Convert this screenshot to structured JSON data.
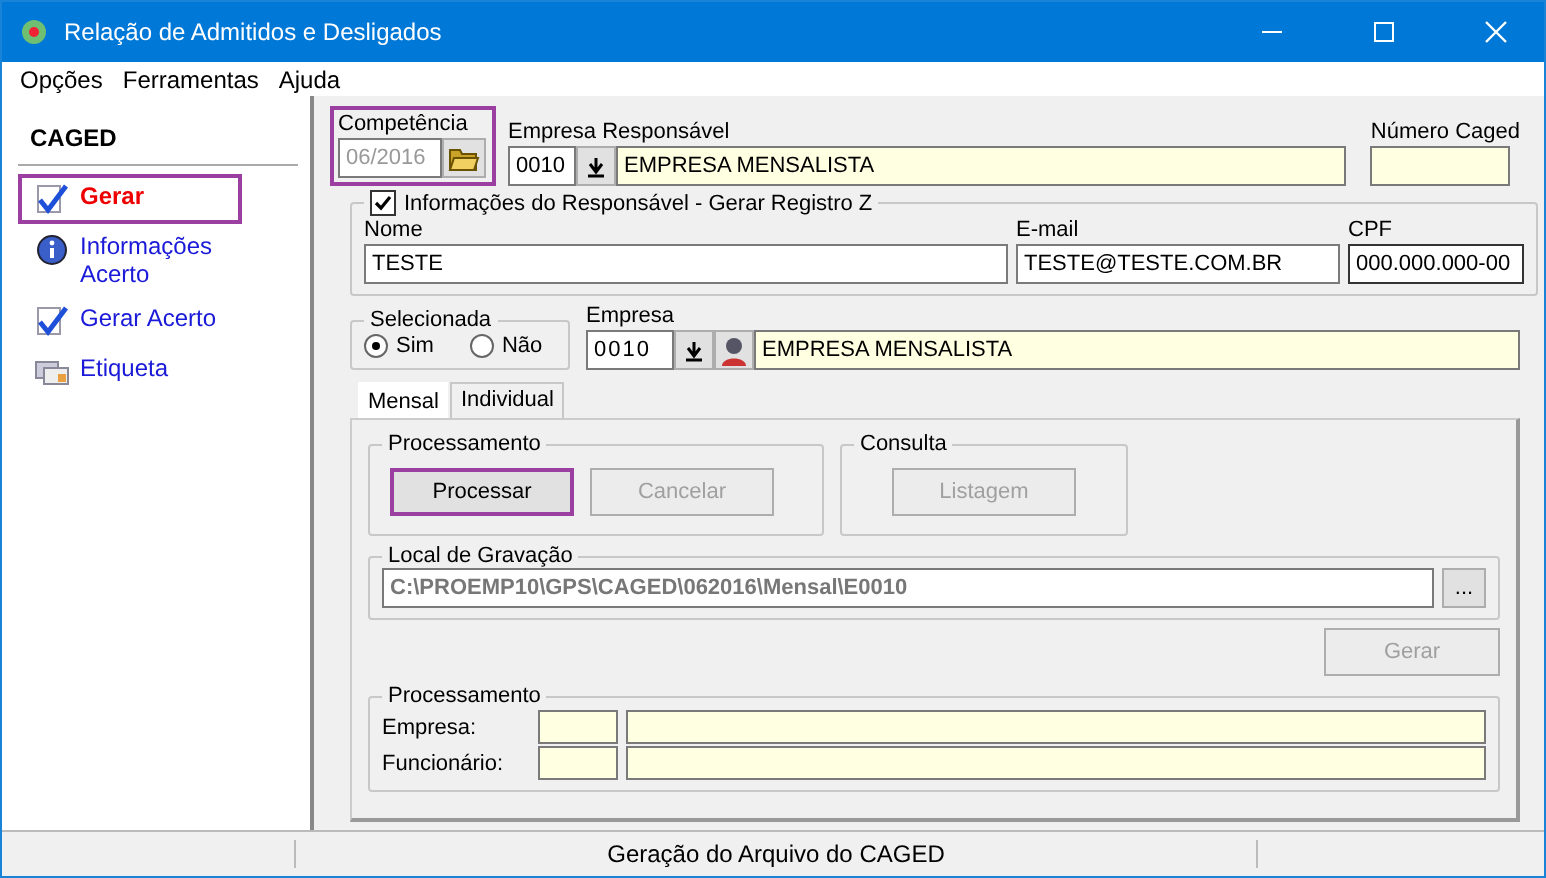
{
  "window": {
    "title": "Relação de Admitidos e Desligados"
  },
  "menu": [
    "Opções",
    "Ferramentas",
    "Ajuda"
  ],
  "sidebar": {
    "title": "CAGED",
    "items": [
      {
        "label": "Gerar",
        "kind": "check",
        "selected": true,
        "highlighted": true
      },
      {
        "label": "Informações Acerto",
        "kind": "info",
        "selected": false,
        "highlighted": false
      },
      {
        "label": "Gerar Acerto",
        "kind": "check",
        "selected": false,
        "highlighted": false
      },
      {
        "label": "Etiqueta",
        "kind": "cards",
        "selected": false,
        "highlighted": false
      }
    ]
  },
  "competencia": {
    "label": "Competência",
    "value": "06/2016",
    "disabled": true,
    "highlighted": true
  },
  "empresa_responsavel": {
    "label": "Empresa Responsável",
    "code": "0010",
    "name": "EMPRESA MENSALISTA"
  },
  "numero_caged": {
    "label": "Número Caged"
  },
  "responsavel": {
    "title": "Informações do Responsável - Gerar Registro Z",
    "checked": true,
    "fields": [
      {
        "label": "Nome",
        "value": "TESTE"
      },
      {
        "label": "E-mail",
        "value": "TESTE@TESTE.COM.BR"
      },
      {
        "label": "CPF",
        "value": "000.000.000-00"
      }
    ]
  },
  "selecionada": {
    "title": "Selecionada",
    "options": [
      {
        "label": "Sim",
        "selected": true
      },
      {
        "label": "Não",
        "selected": false
      }
    ]
  },
  "empresa": {
    "label": "Empresa",
    "code": "0010",
    "name": "EMPRESA MENSALISTA"
  },
  "tabs": [
    {
      "label": "Mensal",
      "selected": true
    },
    {
      "label": "Individual",
      "selected": false
    }
  ],
  "processamento": {
    "title": "Processamento",
    "buttons": [
      {
        "label": "Processar",
        "disabled": false,
        "highlighted": true
      },
      {
        "label": "Cancelar",
        "disabled": true,
        "highlighted": false
      }
    ]
  },
  "consulta": {
    "title": "Consulta",
    "buttons": [
      {
        "label": "Listagem",
        "disabled": true,
        "highlighted": false
      }
    ]
  },
  "local_gravacao": {
    "title": "Local de Gravação",
    "path": "C:\\PROEMP10\\GPS\\CAGED\\062016\\Mensal\\E0010",
    "browse": "..."
  },
  "gerar_button": {
    "label": "Gerar",
    "disabled": true
  },
  "progresso": {
    "title": "Processamento",
    "rows": [
      {
        "label": "Empresa:"
      },
      {
        "label": "Funcionário:"
      }
    ]
  },
  "status_bar": {
    "text": "Geração do Arquivo do CAGED"
  }
}
